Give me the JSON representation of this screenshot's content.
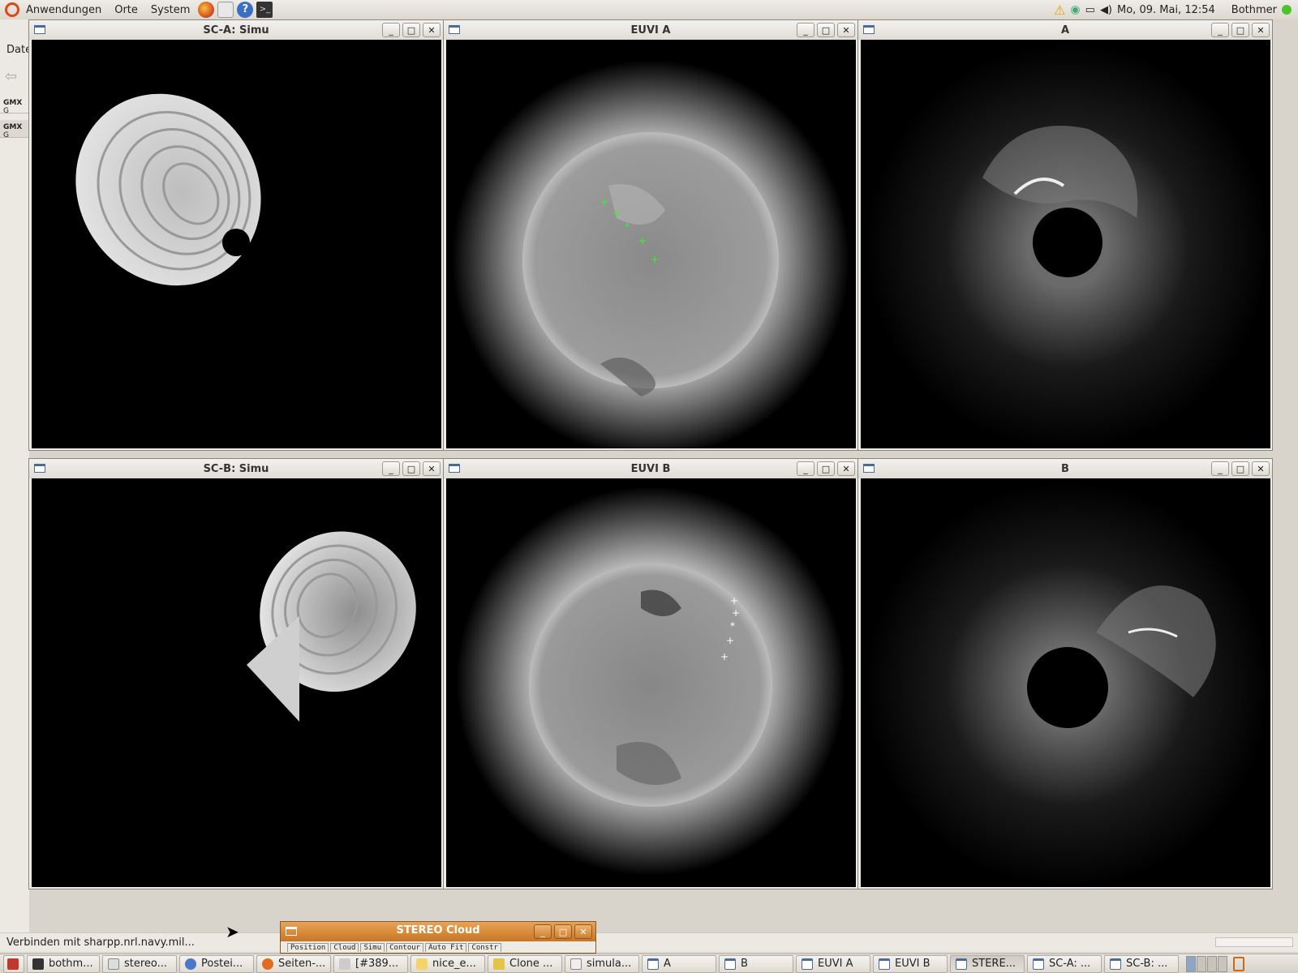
{
  "top_panel": {
    "menus": [
      "Anwendungen",
      "Orte",
      "System"
    ],
    "clock": "Mo, 09. Mai, 12:54",
    "user": "Bothmer"
  },
  "background_browser": {
    "menu_fragment": "Date",
    "tabs": [
      "G",
      "G"
    ]
  },
  "windows": {
    "sc_a": {
      "title": "SC-A: Simu"
    },
    "euvi_a": {
      "title": "EUVI A"
    },
    "cor_a": {
      "title": "A"
    },
    "sc_b": {
      "title": "SC-B: Simu"
    },
    "euvi_b": {
      "title": "EUVI B"
    },
    "cor_b": {
      "title": "B"
    }
  },
  "window_buttons": {
    "minimize": "_",
    "maximize": "□",
    "close": "✕"
  },
  "statusbar": {
    "text": "Verbinden mit sharpp.nrl.navy.mil..."
  },
  "stereo_window": {
    "title": "STEREO Cloud",
    "tabs": [
      "Position",
      "Cloud",
      "Simu",
      "Contour",
      "Auto Fit",
      "Constr"
    ]
  },
  "taskbar": {
    "items": [
      {
        "label": "bothm...",
        "icon": "terminal-icon"
      },
      {
        "label": "stereo...",
        "icon": "document-icon"
      },
      {
        "label": "Postei...",
        "icon": "mail-icon"
      },
      {
        "label": "Seiten-...",
        "icon": "firefox-icon"
      },
      {
        "label": "[#389...",
        "icon": "document-icon"
      },
      {
        "label": "nice_e...",
        "icon": "editor-icon"
      },
      {
        "label": "Clone ...",
        "icon": "app-icon"
      },
      {
        "label": "simula...",
        "icon": "editor-icon"
      },
      {
        "label": "A",
        "icon": "window-icon"
      },
      {
        "label": "B",
        "icon": "window-icon"
      },
      {
        "label": "EUVI A",
        "icon": "window-icon"
      },
      {
        "label": "EUVI B",
        "icon": "window-icon"
      },
      {
        "label": "STERE...",
        "icon": "window-icon"
      },
      {
        "label": "SC-A: ...",
        "icon": "window-icon"
      },
      {
        "label": "SC-B: ...",
        "icon": "window-icon"
      }
    ]
  }
}
